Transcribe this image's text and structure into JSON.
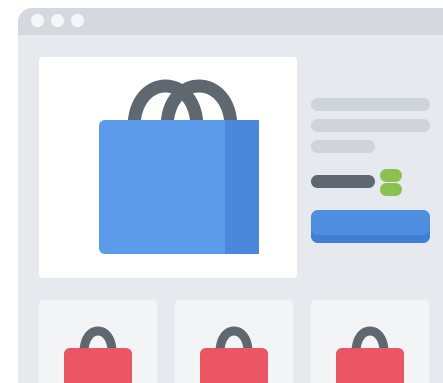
{
  "window": {
    "controls": [
      "close",
      "minimize",
      "maximize"
    ]
  },
  "colors": {
    "window_bg": "#e6e9ee",
    "titlebar": "#d5d9df",
    "card_bg": "#ffffff",
    "bag_blue": "#5b9bea",
    "bag_blue_side": "#4a88dc",
    "bag_red": "#ec5564",
    "bag_red_side": "#d8454f",
    "handle": "#5f6771",
    "placeholder_line": "#cfd4da",
    "accent_green": "#8cc152",
    "button_blue": "#4f8ddf"
  },
  "hero": {
    "icon": "shopping-bag-icon"
  },
  "product_list": [
    {
      "icon": "shopping-bag-icon"
    },
    {
      "icon": "shopping-bag-icon"
    },
    {
      "icon": "shopping-bag-icon"
    }
  ]
}
